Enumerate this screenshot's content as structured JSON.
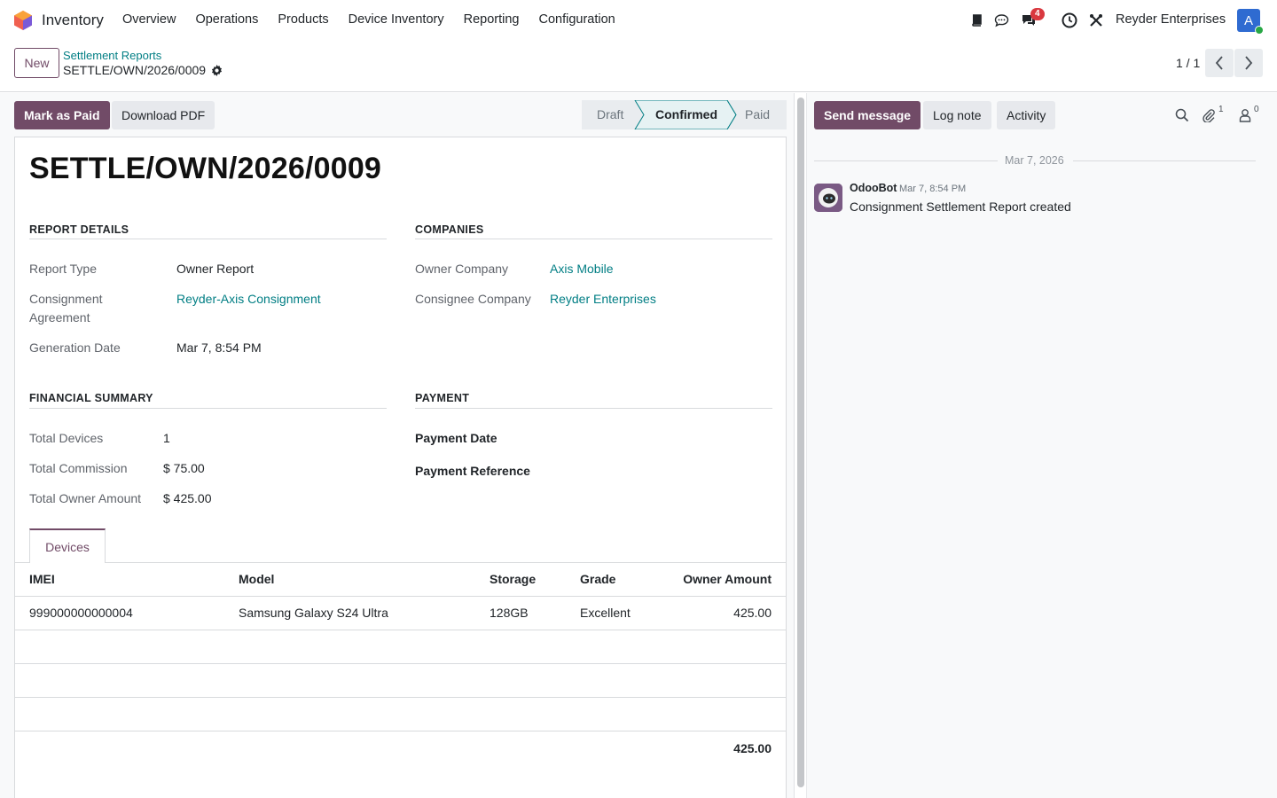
{
  "navbar": {
    "app_name": "Inventory",
    "menu": [
      "Overview",
      "Operations",
      "Products",
      "Device Inventory",
      "Reporting",
      "Configuration"
    ],
    "messages_badge": "4",
    "company": "Reyder Enterprises",
    "avatar_letter": "A"
  },
  "control": {
    "new_label": "New",
    "breadcrumb": "Settlement Reports",
    "record_name": "SETTLE/OWN/2026/0009",
    "pager": "1 / 1"
  },
  "actions": {
    "mark_paid": "Mark as Paid",
    "download_pdf": "Download PDF"
  },
  "statusbar": {
    "stages": [
      "Draft",
      "Confirmed",
      "Paid"
    ],
    "current": "Confirmed"
  },
  "form": {
    "title": "SETTLE/OWN/2026/0009",
    "report_details": {
      "heading": "REPORT DETAILS",
      "report_type_label": "Report Type",
      "report_type": "Owner Report",
      "agreement_label_1": "Consignment",
      "agreement_label_2": "Agreement",
      "agreement": "Reyder-Axis Consignment",
      "generation_date_label": "Generation Date",
      "generation_date": "Mar 7, 8:54 PM"
    },
    "companies": {
      "heading": "COMPANIES",
      "owner_label": "Owner Company",
      "owner": "Axis Mobile",
      "consignee_label": "Consignee Company",
      "consignee": "Reyder Enterprises"
    },
    "financial": {
      "heading": "FINANCIAL SUMMARY",
      "devices_label": "Total Devices",
      "devices": "1",
      "commission_label": "Total Commission",
      "commission": "$ 75.00",
      "owner_amount_label": "Total Owner Amount",
      "owner_amount": "$ 425.00"
    },
    "payment": {
      "heading": "PAYMENT",
      "date_label": "Payment Date",
      "reference_label": "Payment Reference"
    },
    "tab": "Devices",
    "table": {
      "columns": [
        "IMEI",
        "Model",
        "Storage",
        "Grade",
        "Owner Amount"
      ],
      "rows": [
        {
          "imei": "999000000000004",
          "model": "Samsung Galaxy S24 Ultra",
          "storage": "128GB",
          "grade": "Excellent",
          "owner_amount": "425.00"
        }
      ],
      "total": "425.00"
    }
  },
  "chatter": {
    "send_message": "Send message",
    "log_note": "Log note",
    "activity": "Activity",
    "attachments_count": "1",
    "followers_count": "0",
    "date_separator": "Mar 7, 2026",
    "message": {
      "author": "OdooBot",
      "date": "Mar 7, 8:54 PM",
      "body": "Consignment Settlement Report created"
    }
  },
  "colors": {
    "brand": "#714b67",
    "link": "#017e84"
  }
}
